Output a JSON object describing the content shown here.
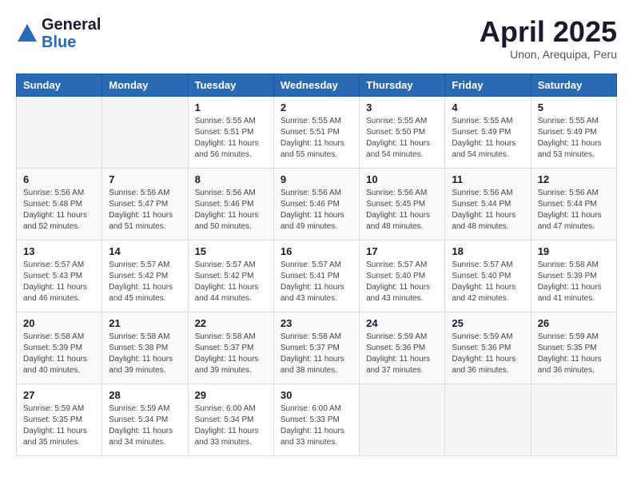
{
  "header": {
    "logo": {
      "general": "General",
      "blue": "Blue"
    },
    "title": "April 2025",
    "subtitle": "Unon, Arequipa, Peru"
  },
  "calendar": {
    "weekdays": [
      "Sunday",
      "Monday",
      "Tuesday",
      "Wednesday",
      "Thursday",
      "Friday",
      "Saturday"
    ],
    "weeks": [
      [
        {
          "day": "",
          "info": ""
        },
        {
          "day": "",
          "info": ""
        },
        {
          "day": "1",
          "info": "Sunrise: 5:55 AM\nSunset: 5:51 PM\nDaylight: 11 hours and 56 minutes."
        },
        {
          "day": "2",
          "info": "Sunrise: 5:55 AM\nSunset: 5:51 PM\nDaylight: 11 hours and 55 minutes."
        },
        {
          "day": "3",
          "info": "Sunrise: 5:55 AM\nSunset: 5:50 PM\nDaylight: 11 hours and 54 minutes."
        },
        {
          "day": "4",
          "info": "Sunrise: 5:55 AM\nSunset: 5:49 PM\nDaylight: 11 hours and 54 minutes."
        },
        {
          "day": "5",
          "info": "Sunrise: 5:55 AM\nSunset: 5:49 PM\nDaylight: 11 hours and 53 minutes."
        }
      ],
      [
        {
          "day": "6",
          "info": "Sunrise: 5:56 AM\nSunset: 5:48 PM\nDaylight: 11 hours and 52 minutes."
        },
        {
          "day": "7",
          "info": "Sunrise: 5:56 AM\nSunset: 5:47 PM\nDaylight: 11 hours and 51 minutes."
        },
        {
          "day": "8",
          "info": "Sunrise: 5:56 AM\nSunset: 5:46 PM\nDaylight: 11 hours and 50 minutes."
        },
        {
          "day": "9",
          "info": "Sunrise: 5:56 AM\nSunset: 5:46 PM\nDaylight: 11 hours and 49 minutes."
        },
        {
          "day": "10",
          "info": "Sunrise: 5:56 AM\nSunset: 5:45 PM\nDaylight: 11 hours and 48 minutes."
        },
        {
          "day": "11",
          "info": "Sunrise: 5:56 AM\nSunset: 5:44 PM\nDaylight: 11 hours and 48 minutes."
        },
        {
          "day": "12",
          "info": "Sunrise: 5:56 AM\nSunset: 5:44 PM\nDaylight: 11 hours and 47 minutes."
        }
      ],
      [
        {
          "day": "13",
          "info": "Sunrise: 5:57 AM\nSunset: 5:43 PM\nDaylight: 11 hours and 46 minutes."
        },
        {
          "day": "14",
          "info": "Sunrise: 5:57 AM\nSunset: 5:42 PM\nDaylight: 11 hours and 45 minutes."
        },
        {
          "day": "15",
          "info": "Sunrise: 5:57 AM\nSunset: 5:42 PM\nDaylight: 11 hours and 44 minutes."
        },
        {
          "day": "16",
          "info": "Sunrise: 5:57 AM\nSunset: 5:41 PM\nDaylight: 11 hours and 43 minutes."
        },
        {
          "day": "17",
          "info": "Sunrise: 5:57 AM\nSunset: 5:40 PM\nDaylight: 11 hours and 43 minutes."
        },
        {
          "day": "18",
          "info": "Sunrise: 5:57 AM\nSunset: 5:40 PM\nDaylight: 11 hours and 42 minutes."
        },
        {
          "day": "19",
          "info": "Sunrise: 5:58 AM\nSunset: 5:39 PM\nDaylight: 11 hours and 41 minutes."
        }
      ],
      [
        {
          "day": "20",
          "info": "Sunrise: 5:58 AM\nSunset: 5:39 PM\nDaylight: 11 hours and 40 minutes."
        },
        {
          "day": "21",
          "info": "Sunrise: 5:58 AM\nSunset: 5:38 PM\nDaylight: 11 hours and 39 minutes."
        },
        {
          "day": "22",
          "info": "Sunrise: 5:58 AM\nSunset: 5:37 PM\nDaylight: 11 hours and 39 minutes."
        },
        {
          "day": "23",
          "info": "Sunrise: 5:58 AM\nSunset: 5:37 PM\nDaylight: 11 hours and 38 minutes."
        },
        {
          "day": "24",
          "info": "Sunrise: 5:59 AM\nSunset: 5:36 PM\nDaylight: 11 hours and 37 minutes."
        },
        {
          "day": "25",
          "info": "Sunrise: 5:59 AM\nSunset: 5:36 PM\nDaylight: 11 hours and 36 minutes."
        },
        {
          "day": "26",
          "info": "Sunrise: 5:59 AM\nSunset: 5:35 PM\nDaylight: 11 hours and 36 minutes."
        }
      ],
      [
        {
          "day": "27",
          "info": "Sunrise: 5:59 AM\nSunset: 5:35 PM\nDaylight: 11 hours and 35 minutes."
        },
        {
          "day": "28",
          "info": "Sunrise: 5:59 AM\nSunset: 5:34 PM\nDaylight: 11 hours and 34 minutes."
        },
        {
          "day": "29",
          "info": "Sunrise: 6:00 AM\nSunset: 5:34 PM\nDaylight: 11 hours and 33 minutes."
        },
        {
          "day": "30",
          "info": "Sunrise: 6:00 AM\nSunset: 5:33 PM\nDaylight: 11 hours and 33 minutes."
        },
        {
          "day": "",
          "info": ""
        },
        {
          "day": "",
          "info": ""
        },
        {
          "day": "",
          "info": ""
        }
      ]
    ]
  }
}
